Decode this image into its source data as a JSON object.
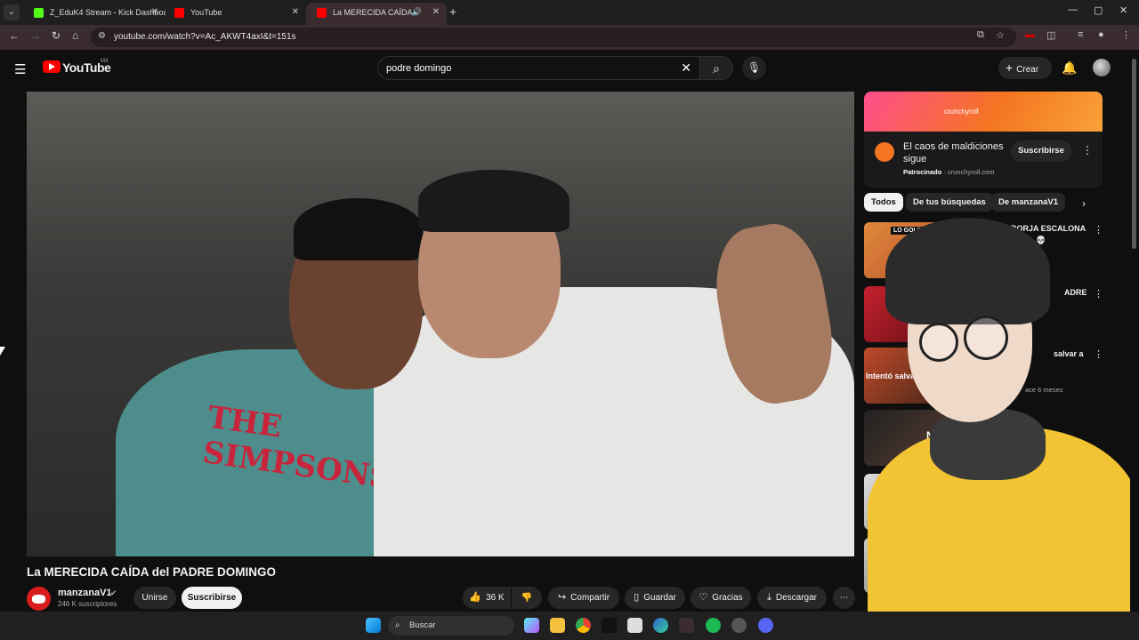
{
  "browser": {
    "tabs": [
      {
        "title": "Z_EduK4 Stream - Kick Dashboa",
        "favicon_color": "#53fc18",
        "active": false
      },
      {
        "title": "YouTube",
        "favicon_color": "#ff0000",
        "active": false
      },
      {
        "title": "La MERECIDA CAÍDA del PA",
        "favicon_color": "#ff0000",
        "active": true
      }
    ],
    "tab_close_glyph": "✕",
    "new_tab_glyph": "+",
    "url": "youtube.com/watch?v=Ac_AKWT4axI&t=151s",
    "window_controls": [
      "—",
      "▢",
      "✕"
    ]
  },
  "youtube": {
    "wordmark": "YouTube",
    "country": "MX",
    "search": {
      "query": "podre domingo"
    },
    "create_label": "Crear"
  },
  "video": {
    "title": "La MERECIDA CAÍDA del PADRE DOMINGO",
    "shirt_print": "THE SIMPSONS",
    "channel": {
      "name": "manzanaV1",
      "subscribers": "246 K suscriptores"
    },
    "join_label": "Unirse",
    "subscribe_label": "Suscribirse",
    "likes": "36 K",
    "share_label": "Compartir",
    "save_label": "Guardar",
    "thanks_label": "Gracias",
    "download_label": "Descargar"
  },
  "ad": {
    "brand": "crunchyroll",
    "title": "El caos de maldiciones sigue",
    "sponsored_label": "Patrocinado",
    "domain": "crunchyroll.com",
    "subscribe_label": "Suscribirse"
  },
  "chips": [
    "Todos",
    "De tus búsquedas",
    "De manzanaV1"
  ],
  "recommendations": [
    {
      "title": "BORJA ESCALONA y NAL 💀",
      "thumb_label": "LO GOLPEARON",
      "meta": ""
    },
    {
      "title": "ADRE",
      "thumb_label": "",
      "meta": ""
    },
    {
      "title": "salvar a",
      "thumb_label": "Intentó salvar",
      "meta": "ace 6 meses"
    },
    {
      "title": "",
      "thumb_label": "NO",
      "meta": ""
    },
    {
      "title": "",
      "thumb_label": "",
      "meta": ""
    }
  ],
  "taskbar": {
    "search_label": "Buscar"
  },
  "colors": {
    "accent": "#ff0000",
    "crunchyroll": "#f47521",
    "tab_active_bg": "#3a2c2f"
  }
}
